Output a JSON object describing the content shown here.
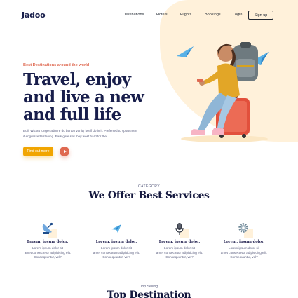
{
  "colors": {
    "accent": "#DF6951",
    "button": "#F1A501",
    "heading": "#181E4B",
    "blob": "#FFF1DA"
  },
  "nav": {
    "logo": "Jadoo",
    "links": [
      "Destinations",
      "Hotels",
      "Flights",
      "Bookings",
      "Login"
    ],
    "signin_label": "Sign up"
  },
  "hero": {
    "tagline": "Best Destinations around the world",
    "title_lines": [
      "Travel, enjoy",
      "and live a new",
      "and full life"
    ],
    "description": "Built Wicket longer admire do barton vanity itself do in it. Preferred to sportsmen it engrossed listening. Park gate sell they west hard for the.",
    "cta_label": "Find out more",
    "play_icon": "play-icon"
  },
  "services": {
    "category": "CATEGORY",
    "title": "We Offer Best Services",
    "items": [
      {
        "icon": "satellite-dish-icon",
        "title": "Lorem, ipsum dolor.",
        "desc_lines": [
          "Lorem ipsum dolor sit",
          "amet consectetur adipisicing elit.",
          "Consequuntur, vel?"
        ]
      },
      {
        "icon": "airplane-icon",
        "title": "Lorem, ipsum dolor.",
        "desc_lines": [
          "Lorem ipsum dolor sit",
          "amet consectetur adipisicing elit.",
          "Consequuntur, vel?"
        ]
      },
      {
        "icon": "microphone-icon",
        "title": "Lorem, ipsum dolor.",
        "desc_lines": [
          "Lorem ipsum dolor sit",
          "amet consectetur adipisicing elit.",
          "Consequuntur, vel?"
        ]
      },
      {
        "icon": "gear-icon",
        "title": "Lorem, ipsum dolor.",
        "desc_lines": [
          "Lorem ipsum dolor sit",
          "amet consectetur adipisicing elit.",
          "Consequuntur, vel?"
        ]
      }
    ]
  },
  "top_selling": {
    "label": "Top Selling",
    "title": "Top Destination"
  }
}
